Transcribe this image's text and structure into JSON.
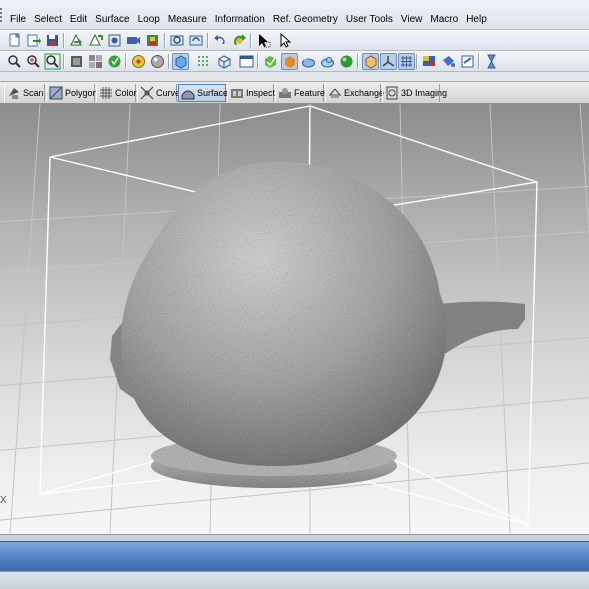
{
  "menu": {
    "items": [
      "File",
      "Select",
      "Edit",
      "Surface",
      "Loop",
      "Measure",
      "Information",
      "Ref. Geometry",
      "User Tools",
      "View",
      "Macro",
      "Help"
    ]
  },
  "toolbar1": {
    "icons": [
      "new-file-icon",
      "open-file-icon",
      "save-file-icon",
      "import-icon",
      "export-icon",
      "snapshot-icon",
      "record-icon",
      "print-icon",
      "search-object-icon",
      "rotate-view-icon",
      "undo-icon",
      "redo-icon",
      "select-pointer-icon",
      "select-arrow-icon"
    ]
  },
  "toolbar2": {
    "icons": [
      "zoom-icon",
      "zoom-in-icon",
      "zoom-fit-icon",
      "pan-icon",
      "refresh-icon",
      "view-cube-icon",
      "render-sphere-icon",
      "shaded-mode-icon",
      "points-mode-icon",
      "box-mode-icon",
      "window-icon",
      "check-shape-icon",
      "heart-shape-icon",
      "cloud-shape-icon",
      "cloud2-shape-icon",
      "green-sphere-icon",
      "bounding-box-icon",
      "axis-icon",
      "grid-icon",
      "color-map-icon",
      "bucket-icon",
      "hide-icon",
      "hourglass-icon"
    ]
  },
  "modules": {
    "active": "Surface",
    "tabs": [
      {
        "label": "Scan",
        "icon": "scan-icon"
      },
      {
        "label": "Polygon",
        "icon": "polygon-icon"
      },
      {
        "label": "Color",
        "icon": "color-icon"
      },
      {
        "label": "Curve",
        "icon": "curve-icon"
      },
      {
        "label": "Surface",
        "icon": "surface-icon"
      },
      {
        "label": "Inspect",
        "icon": "inspect-icon"
      },
      {
        "label": "Feature",
        "icon": "feature-icon"
      },
      {
        "label": "Exchange",
        "icon": "exchange-icon"
      },
      {
        "label": "3D Imaging",
        "icon": "3d-imaging-icon"
      }
    ]
  },
  "viewport": {
    "axis_label": "X",
    "model": "scanned-bulb-point-cloud",
    "colors": {
      "bbox": "#ffffff",
      "grid": "#bfbfbf",
      "model": "#9a9a9a"
    }
  }
}
